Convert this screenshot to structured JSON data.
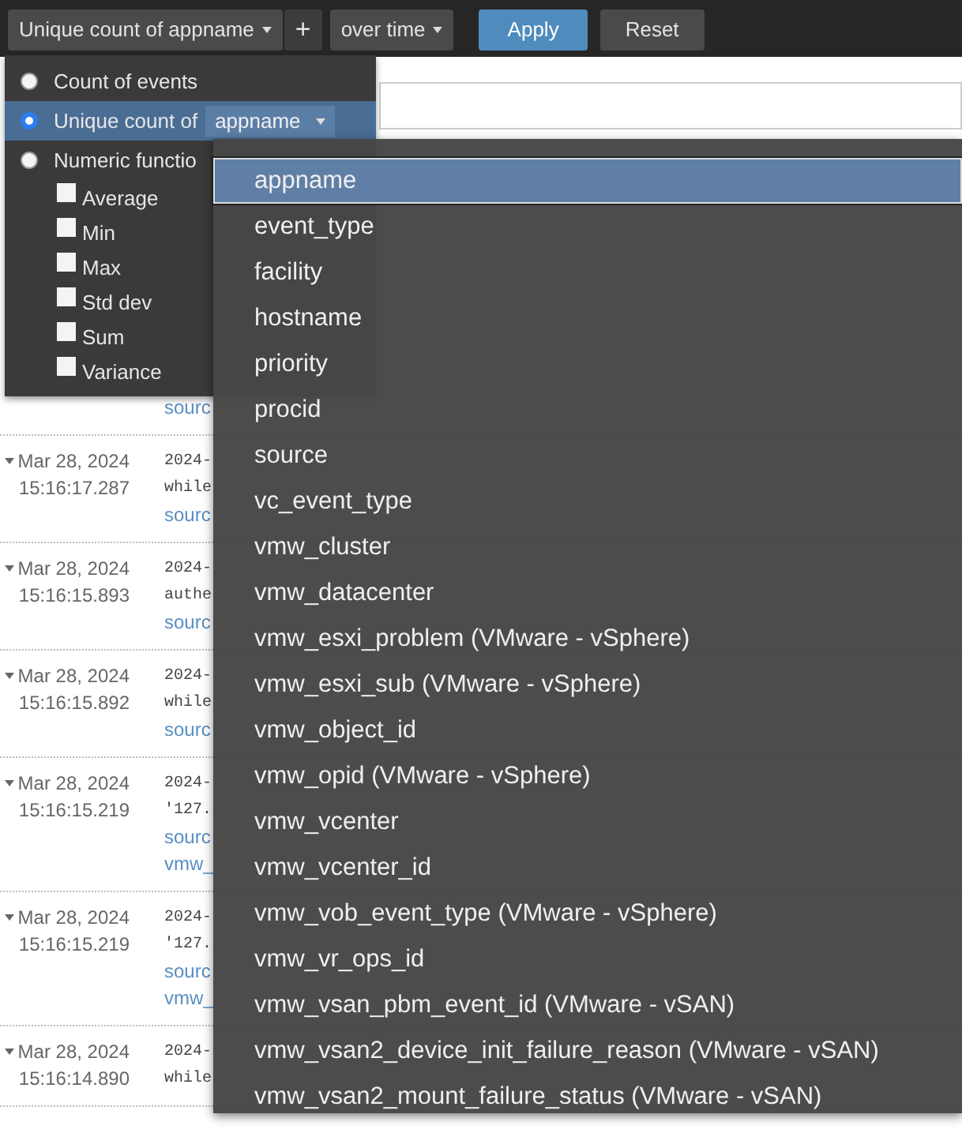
{
  "toolbar": {
    "function_button": {
      "label": "Unique count of appname"
    },
    "add_button": "+",
    "time_button": {
      "label": "over time"
    },
    "apply_button": "Apply",
    "reset_button": "Reset"
  },
  "function_menu": {
    "options": [
      {
        "kind": "radio",
        "label": "Count of events",
        "selected": false
      },
      {
        "kind": "field",
        "label": "Unique count of",
        "selected": true,
        "field": "appname"
      },
      {
        "kind": "radio",
        "label": "Numeric functio",
        "selected": false
      }
    ],
    "checkboxes": [
      {
        "label": "Average",
        "checked": false
      },
      {
        "label": "Min",
        "checked": false
      },
      {
        "label": "Max",
        "checked": false
      },
      {
        "label": "Std dev",
        "checked": false
      },
      {
        "label": "Sum",
        "checked": false
      },
      {
        "label": "Variance",
        "checked": false
      }
    ]
  },
  "field_dropdown": {
    "items": [
      {
        "label": "appname",
        "selected": true
      },
      {
        "label": "event_type",
        "selected": false
      },
      {
        "label": "facility",
        "selected": false
      },
      {
        "label": "hostname",
        "selected": false
      },
      {
        "label": "priority",
        "selected": false
      },
      {
        "label": "procid",
        "selected": false
      },
      {
        "label": "source",
        "selected": false
      },
      {
        "label": "vc_event_type",
        "selected": false
      },
      {
        "label": "vmw_cluster",
        "selected": false
      },
      {
        "label": "vmw_datacenter",
        "selected": false
      },
      {
        "label": "vmw_esxi_problem (VMware - vSphere)",
        "selected": false
      },
      {
        "label": "vmw_esxi_sub (VMware - vSphere)",
        "selected": false
      },
      {
        "label": "vmw_object_id",
        "selected": false
      },
      {
        "label": "vmw_opid (VMware - vSphere)",
        "selected": false
      },
      {
        "label": "vmw_vcenter",
        "selected": false
      },
      {
        "label": "vmw_vcenter_id",
        "selected": false
      },
      {
        "label": "vmw_vob_event_type (VMware - vSphere)",
        "selected": false
      },
      {
        "label": "vmw_vr_ops_id",
        "selected": false
      },
      {
        "label": "vmw_vsan_pbm_event_id (VMware - vSAN)",
        "selected": false
      },
      {
        "label": "vmw_vsan2_device_init_failure_reason (VMware - vSAN)",
        "selected": false
      },
      {
        "label": "vmw_vsan2_mount_failure_status (VMware - vSAN)",
        "selected": false
      }
    ]
  },
  "events": [
    {
      "lines": [
        {
          "kind": "link",
          "text": "sourc"
        }
      ]
    },
    {
      "date": "Mar 28, 2024",
      "time": "15:16:17.287",
      "lines": [
        {
          "kind": "text",
          "text": "2024-"
        },
        {
          "kind": "text",
          "text": "while"
        },
        {
          "kind": "link",
          "text": "sourc"
        }
      ]
    },
    {
      "date": "Mar 28, 2024",
      "time": "15:16:15.893",
      "lines": [
        {
          "kind": "text",
          "text": "2024-"
        },
        {
          "kind": "text",
          "text": "authe"
        },
        {
          "kind": "link",
          "text": "sourc"
        }
      ]
    },
    {
      "date": "Mar 28, 2024",
      "time": "15:16:15.892",
      "lines": [
        {
          "kind": "text",
          "text": "2024-"
        },
        {
          "kind": "text",
          "text": "while"
        },
        {
          "kind": "link",
          "text": "sourc"
        }
      ]
    },
    {
      "date": "Mar 28, 2024",
      "time": "15:16:15.219",
      "lines": [
        {
          "kind": "text",
          "text": "2024-"
        },
        {
          "kind": "text",
          "text": "'127."
        },
        {
          "kind": "link",
          "text": "sourc"
        },
        {
          "kind": "link",
          "text": "vmw_"
        }
      ]
    },
    {
      "date": "Mar 28, 2024",
      "time": "15:16:15.219",
      "lines": [
        {
          "kind": "text",
          "text": "2024-"
        },
        {
          "kind": "text",
          "text": "'127."
        },
        {
          "kind": "link",
          "text": "sourc"
        },
        {
          "kind": "link",
          "text": "vmw_"
        }
      ]
    },
    {
      "date": "Mar 28, 2024",
      "time": "15:16:14.890",
      "lines": [
        {
          "kind": "text",
          "text": "2024-"
        },
        {
          "kind": "text",
          "text": "while"
        }
      ]
    }
  ]
}
